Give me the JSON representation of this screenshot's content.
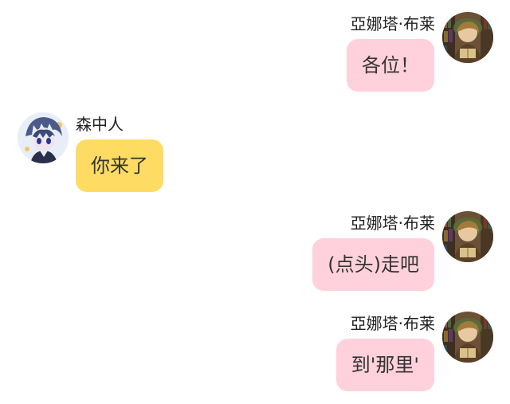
{
  "colors": {
    "right_bubble": "#ffd1dc",
    "left_bubble": "#fedc63",
    "name_text": "#222222",
    "bubble_text": "#333333"
  },
  "messages": [
    {
      "side": "right",
      "sender": "亞娜塔·布莱",
      "text": "各位！",
      "avatar": "reader-avatar-icon"
    },
    {
      "side": "left",
      "sender": "森中人",
      "text": "你来了",
      "avatar": "anime-boy-avatar-icon"
    },
    {
      "side": "right",
      "sender": "亞娜塔·布莱",
      "text": "(点头)走吧",
      "avatar": "reader-avatar-icon"
    },
    {
      "side": "right",
      "sender": "亞娜塔·布莱",
      "text": "到'那里'",
      "avatar": "reader-avatar-icon"
    }
  ]
}
